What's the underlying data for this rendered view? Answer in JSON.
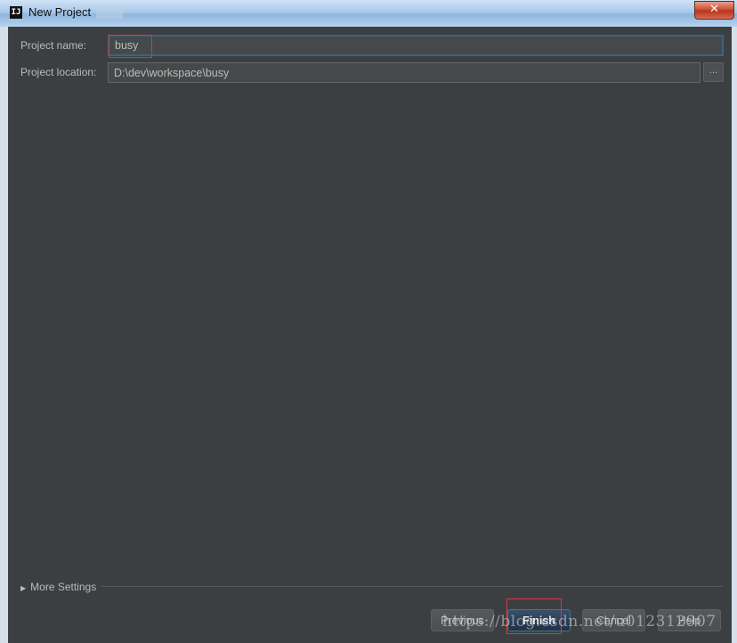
{
  "window": {
    "title": "New Project",
    "app_icon_text": "IJ",
    "close_symbol": "✕"
  },
  "form": {
    "name_label": "Project name:",
    "name_value": "busy",
    "location_label": "Project location:",
    "location_value": "D:\\dev\\workspace\\busy",
    "browse_label": "..."
  },
  "more_settings": {
    "label": "More Settings",
    "expanded": false
  },
  "buttons": {
    "previous": "Previous",
    "finish": "Finish",
    "cancel": "Cancel",
    "help": "Help"
  },
  "watermark": "https://blog.csdn.net/u012312907",
  "colors": {
    "dialog_bg": "#3c3f41",
    "highlight_red": "#e0353a",
    "text": "#bbbbbb"
  }
}
